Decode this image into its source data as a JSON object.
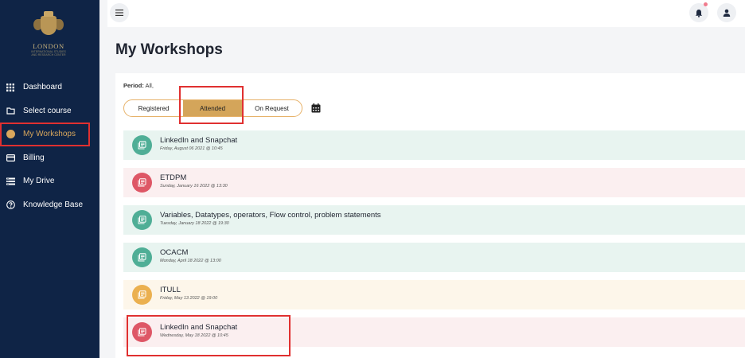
{
  "brand": {
    "name": "LONDON",
    "tagline1": "INTERNATIONAL STUDIES",
    "tagline2": "AND RESEARCH CENTER"
  },
  "sidebar": {
    "items": [
      {
        "label": "Dashboard",
        "icon": "grid-icon"
      },
      {
        "label": "Select course",
        "icon": "folder-icon"
      },
      {
        "label": "My Workshops",
        "icon": "workshop-icon",
        "active": true
      },
      {
        "label": "Billing",
        "icon": "card-icon"
      },
      {
        "label": "My Drive",
        "icon": "drive-icon"
      },
      {
        "label": "Knowledge Base",
        "icon": "help-icon"
      }
    ]
  },
  "page": {
    "title": "My Workshops",
    "period_label": "Period:",
    "period_value": "All,"
  },
  "tabs": [
    {
      "label": "Registered"
    },
    {
      "label": "Attended",
      "active": true
    },
    {
      "label": "On Request"
    }
  ],
  "workshops": [
    {
      "title": "LinkedIn and Snapchat",
      "date": "Friday, August 06 2021 @ 10:45",
      "color": "green"
    },
    {
      "title": "ETDPM",
      "date": "Sunday, January 16 2022 @ 13:30",
      "color": "red"
    },
    {
      "title": "Variables, Datatypes, operators, Flow control, problem statements",
      "date": "Tuesday, January 18 2022 @ 19:30",
      "color": "green"
    },
    {
      "title": "OCACM",
      "date": "Monday, April 18 2022 @ 13:00",
      "color": "green"
    },
    {
      "title": "ITULL",
      "date": "Friday, May 13 2022 @ 19:00",
      "color": "yellow"
    },
    {
      "title": "LinkedIn and Snapchat",
      "date": "Wednesday, May 18 2022 @ 10:45",
      "color": "red"
    }
  ],
  "colors": {
    "sidebar_bg": "#0f2446",
    "accent": "#d4a55a",
    "highlight": "#e03030"
  }
}
